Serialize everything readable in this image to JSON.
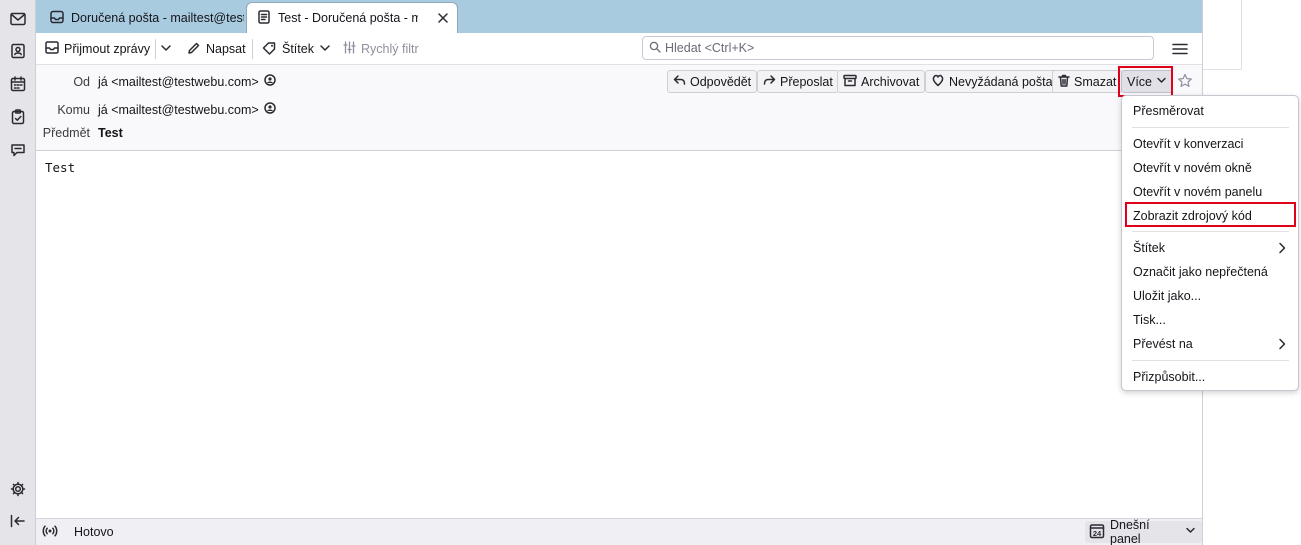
{
  "tabs": [
    {
      "title": "Doručená pošta - mailtest@testwebu.com",
      "icon": "inbox-icon"
    },
    {
      "title": "Test - Doručená pošta - mailtest@testwebu.com",
      "icon": "message-icon"
    }
  ],
  "toolbar": {
    "get_messages": "Přijmout zprávy",
    "write": "Napsat",
    "tag": "Štítek",
    "quick_filter": "Rychlý filtr",
    "search_placeholder": "Hledat <Ctrl+K>"
  },
  "header": {
    "from_label": "Od",
    "from_value": "já <mailtest@testwebu.com>",
    "to_label": "Komu",
    "to_value": "já <mailtest@testwebu.com>",
    "subject_label": "Předmět",
    "subject_value": "Test",
    "buttons": {
      "reply": "Odpovědět",
      "forward": "Přeposlat",
      "archive": "Archivovat",
      "junk": "Nevyžádaná pošta",
      "delete": "Smazat",
      "more": "Více"
    }
  },
  "body": {
    "text": "Test"
  },
  "status": {
    "text": "Hotovo",
    "today_pane": "Dnešní panel"
  },
  "menu": {
    "items": [
      "Přesměrovat",
      "Otevřít v konverzaci",
      "Otevřít v novém okně",
      "Otevřít v novém panelu",
      "Zobrazit zdrojový kód",
      "Štítek",
      "Označit jako nepřečtená",
      "Uložit jako...",
      "Tisk...",
      "Převést na",
      "Přizpůsobit..."
    ]
  },
  "colors": {
    "tabbar": "#a8cbe0",
    "highlight": "#e0001a"
  }
}
